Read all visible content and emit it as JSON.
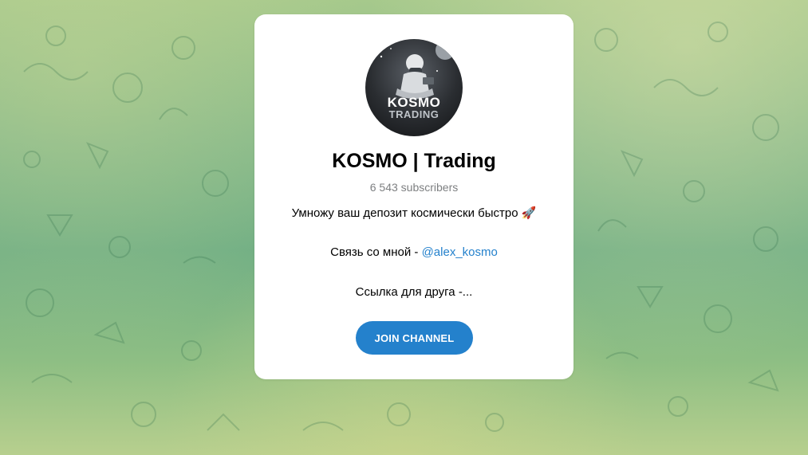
{
  "channel": {
    "title": "KOSMO | Trading",
    "subscribers": "6 543 subscribers",
    "avatar_brand": "KOSMO",
    "avatar_brand_sub": "TRADING",
    "description_line1": "Умножу ваш депозит космически быстро 🚀",
    "contact_prefix": "Связь со мной - ",
    "contact_link": "@alex_kosmo",
    "description_line3": "Ссылка для друга -..."
  },
  "actions": {
    "join_label": "JOIN CHANNEL"
  },
  "colors": {
    "accent": "#2481cc",
    "muted_text": "#7d7f81",
    "card_bg": "#ffffff"
  }
}
